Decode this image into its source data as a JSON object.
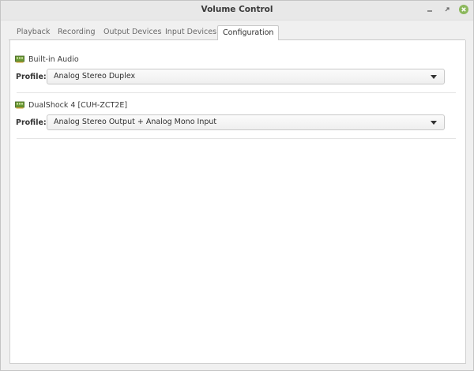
{
  "window": {
    "title": "Volume Control"
  },
  "tabs": [
    {
      "label": "Playback",
      "active": false
    },
    {
      "label": "Recording",
      "active": false
    },
    {
      "label": "Output Devices",
      "active": false
    },
    {
      "label": "Input Devices",
      "active": false
    },
    {
      "label": "Configuration",
      "active": true
    }
  ],
  "cards": [
    {
      "device_name": "Built-in Audio",
      "profile_label": "Profile:",
      "profile_value": "Analog Stereo Duplex",
      "icon": "sound-card-icon"
    },
    {
      "device_name": "DualShock 4 [CUH-ZCT2E]",
      "profile_label": "Profile:",
      "profile_value": "Analog Stereo Output + Analog Mono Input",
      "icon": "sound-card-icon"
    }
  ],
  "colors": {
    "close_button": "#8cb85c",
    "icon_green": "#5a8a2a"
  }
}
